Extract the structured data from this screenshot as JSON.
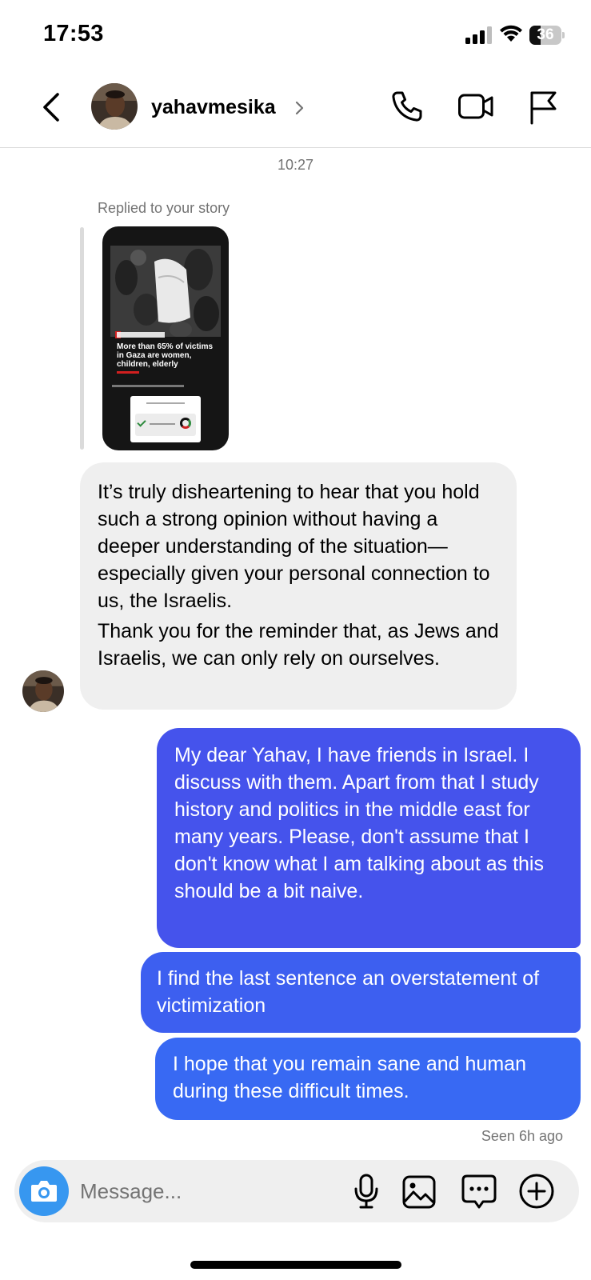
{
  "status_bar": {
    "time": "17:53",
    "battery_level": "36",
    "battery_percent": 36
  },
  "header": {
    "username": "yahavmesika"
  },
  "conversation": {
    "timestamp": "10:27",
    "reply_label": "Replied to your story",
    "story": {
      "headline": "More than 65% of victims in Gaza are women, children, elderly"
    },
    "incoming_message": {
      "paragraph_1": "It’s truly disheartening to hear that you hold such a strong opinion without having a deeper understanding of the situation—especially given your personal connection to us, the Israelis.",
      "paragraph_2": "Thank you for the reminder that, as Jews and Israelis, we can only rely on ourselves."
    },
    "outgoing_messages": [
      {
        "text": "My dear Yahav, I have friends in Israel. I discuss with them. Apart from that I study history and politics in the middle east for many years. Please, don't assume that I don't know what I am talking about as this should be a bit naive."
      },
      {
        "text": "I find the last sentence an overstatement of victimization"
      },
      {
        "text": "I hope that you remain sane and human during these difficult times."
      }
    ],
    "seen_status": "Seen 6h ago"
  },
  "composer": {
    "placeholder": "Message..."
  },
  "icons": {
    "back": "chevron-left-icon",
    "call": "phone-icon",
    "video": "video-camera-icon",
    "report": "flag-icon",
    "camera": "camera-icon",
    "mic": "microphone-icon",
    "gallery": "image-icon",
    "sticker": "message-bubble-icon",
    "add": "plus-circle-icon"
  },
  "colors": {
    "outgoing_bubble_top": "#4553ec",
    "outgoing_bubble_bottom": "#3869f3",
    "incoming_bubble": "#efefef",
    "camera_button": "#3797f0",
    "secondary_text": "#737373"
  }
}
